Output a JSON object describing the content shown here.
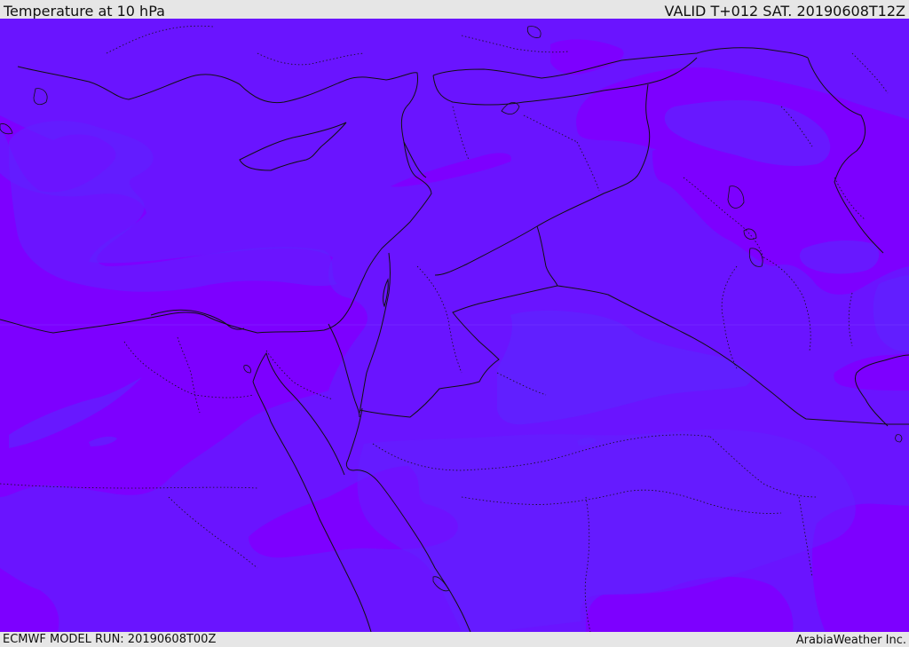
{
  "header": {
    "title": "Temperature at 10 hPa",
    "valid_time": "VALID T+012 SAT. 20190608T12Z"
  },
  "footer": {
    "model_run": "ECMWF MODEL RUN: 20190608T00Z",
    "credit": "ArabiaWeather Inc."
  },
  "colors": {
    "field_base": "#6a14ff",
    "field_warm": "#7d00ff",
    "field_cool": "#5f22ff",
    "coastline": "#111111",
    "border": "#111111",
    "frame": "#e6e6e6"
  }
}
